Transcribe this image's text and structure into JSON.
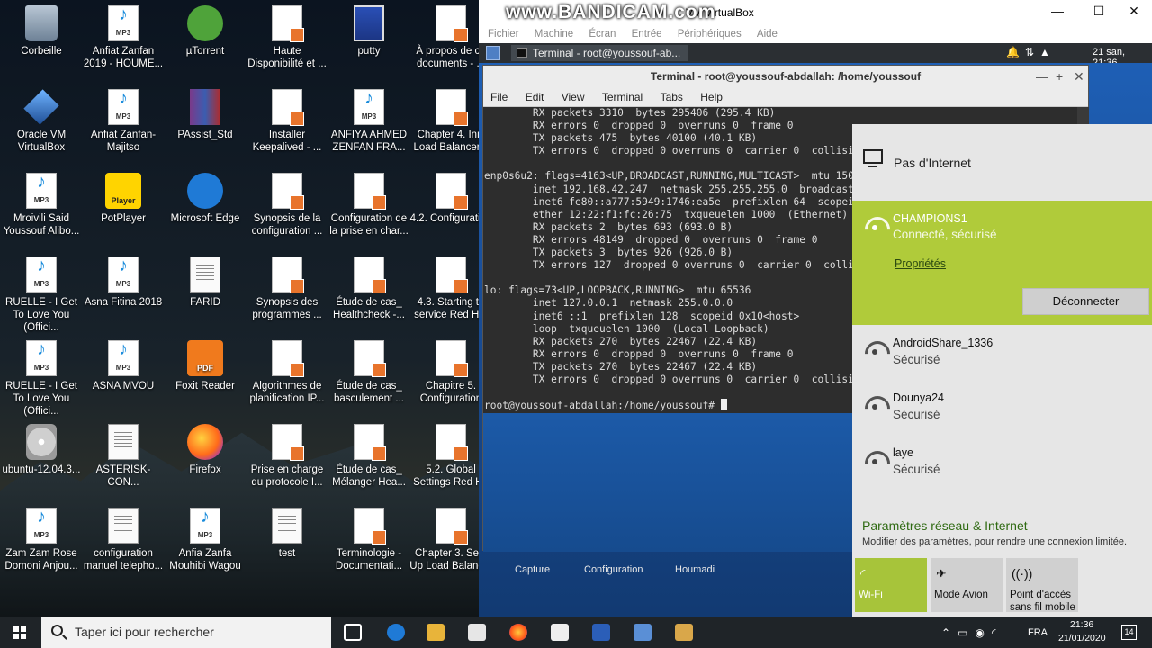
{
  "desktop": {
    "icons": [
      {
        "label": "Corbeille"
      },
      {
        "label": "Anfiat Zanfan 2019 - HOUME..."
      },
      {
        "label": "µTorrent"
      },
      {
        "label": "Haute Disponibilité et ..."
      },
      {
        "label": "putty"
      },
      {
        "label": "À propos de ce documents - ..."
      },
      {
        "label": "Oracle VM VirtualBox"
      },
      {
        "label": "Anfiat Zanfan- Majitso"
      },
      {
        "label": "PAssist_Std"
      },
      {
        "label": "Installer Keepalived - ..."
      },
      {
        "label": "ANFIYA AHMED ZENFAN FRA..."
      },
      {
        "label": "Chapter 4. Initi Load Balancer..."
      },
      {
        "label": "Mroivili Said Youssouf Alibo..."
      },
      {
        "label": "PotPlayer"
      },
      {
        "label": "Microsoft Edge"
      },
      {
        "label": "Synopsis de la configuration ..."
      },
      {
        "label": "Configuration de la prise en char..."
      },
      {
        "label": "4.2. Configuration"
      },
      {
        "label": "RUELLE - I Get To Love You (Offici..."
      },
      {
        "label": "Asna Fitina 2018"
      },
      {
        "label": "FARID"
      },
      {
        "label": "Synopsis des programmes ..."
      },
      {
        "label": "Étude de cas_ Healthcheck -..."
      },
      {
        "label": "4.3. Starting th service Red Hat"
      },
      {
        "label": "RUELLE - I Get To Love You (Offici..."
      },
      {
        "label": "ASNA MVOU"
      },
      {
        "label": "Foxit Reader"
      },
      {
        "label": "Algorithmes de planification IP..."
      },
      {
        "label": "Étude de cas_ basculement ..."
      },
      {
        "label": "Chapitre 5. Configuration"
      },
      {
        "label": "ubuntu-12.04.3..."
      },
      {
        "label": "ASTERISK-CON..."
      },
      {
        "label": "Firefox"
      },
      {
        "label": "Prise en charge du protocole I..."
      },
      {
        "label": "Étude de cas_ Mélanger Hea..."
      },
      {
        "label": "5.2. Global Settings Red Ha"
      },
      {
        "label": "Zam Zam Rose Domoni Anjou..."
      },
      {
        "label": "configuration manuel telepho..."
      },
      {
        "label": "Anfia Zanfa Mouhibi Wagou"
      },
      {
        "label": "test"
      },
      {
        "label": "Terminologie - Documentati..."
      },
      {
        "label": "Chapter 3. Setti Up Load Balanc..."
      }
    ],
    "icon_badges": {
      "potplayer": "Player",
      "foxit": "PDF"
    }
  },
  "recording_watermark": "www.BANDICAM.com",
  "virtualbox": {
    "title": "VM VirtualBox",
    "menu": [
      "Fichier",
      "Machine",
      "Écran",
      "Entrée",
      "Périphériques",
      "Aide"
    ],
    "guest_task_label": "Terminal - root@youssouf-ab...",
    "guest_clock": "21 san, 21:36",
    "guest_desktop_labels": [
      "Capture",
      "Configuration",
      "Houmadi"
    ]
  },
  "terminal": {
    "title": "Terminal - root@youssouf-abdallah: /home/youssouf",
    "menu": [
      "File",
      "Edit",
      "View",
      "Terminal",
      "Tabs",
      "Help"
    ],
    "lines": [
      "        RX packets 3310  bytes 295406 (295.4 KB)",
      "        RX errors 0  dropped 0  overruns 0  frame 0",
      "        TX packets 475  bytes 40100 (40.1 KB)",
      "        TX errors 0  dropped 0 overruns 0  carrier 0  collision",
      "",
      "enp0s6u2: flags=4163<UP,BROADCAST,RUNNING,MULTICAST>  mtu 1500",
      "        inet 192.168.42.247  netmask 255.255.255.0  broadcast",
      "        inet6 fe80::a777:5949:1746:ea5e  prefixlen 64  scopeid",
      "        ether 12:22:f1:fc:26:75  txqueuelen 1000  (Ethernet)",
      "        RX packets 2  bytes 693 (693.0 B)",
      "        RX errors 48149  dropped 0  overruns 0  frame 0",
      "        TX packets 3  bytes 926 (926.0 B)",
      "        TX errors 127  dropped 0 overruns 0  carrier 0  collis.",
      "",
      "lo: flags=73<UP,LOOPBACK,RUNNING>  mtu 65536",
      "        inet 127.0.0.1  netmask 255.0.0.0",
      "        inet6 ::1  prefixlen 128  scopeid 0x10<host>",
      "        loop  txqueuelen 1000  (Local Loopback)",
      "        RX packets 270  bytes 22467 (22.4 KB)",
      "        RX errors 0  dropped 0  overruns 0  frame 0",
      "        TX packets 270  bytes 22467 (22.4 KB)",
      "        TX errors 0  dropped 0 overruns 0  carrier 0  collision",
      ""
    ],
    "prompt": "root@youssouf-abdallah:/home/youssouf# "
  },
  "network_flyout": {
    "no_internet": "Pas d'Internet",
    "connected": {
      "name": "CHAMPIONS1",
      "status": "Connecté, sécurisé",
      "properties": "Propriétés",
      "disconnect": "Déconnecter"
    },
    "networks": [
      {
        "name": "AndroidShare_1336",
        "status": "Sécurisé"
      },
      {
        "name": "Dounya24",
        "status": "Sécurisé"
      },
      {
        "name": "laye",
        "status": "Sécurisé"
      }
    ],
    "settings_title": "Paramètres réseau & Internet",
    "settings_sub": "Modifier des paramètres, pour rendre une connexion limitée.",
    "quick_actions": [
      {
        "label": "Wi-Fi"
      },
      {
        "label": "Mode Avion"
      },
      {
        "label": "Point d'accès sans fil mobile"
      }
    ],
    "accent_color": "#b0cb3a"
  },
  "taskbar": {
    "search_placeholder": "Taper ici pour rechercher",
    "language": "FRA",
    "time": "21:36",
    "date": "21/01/2020",
    "notification_count": "14"
  }
}
